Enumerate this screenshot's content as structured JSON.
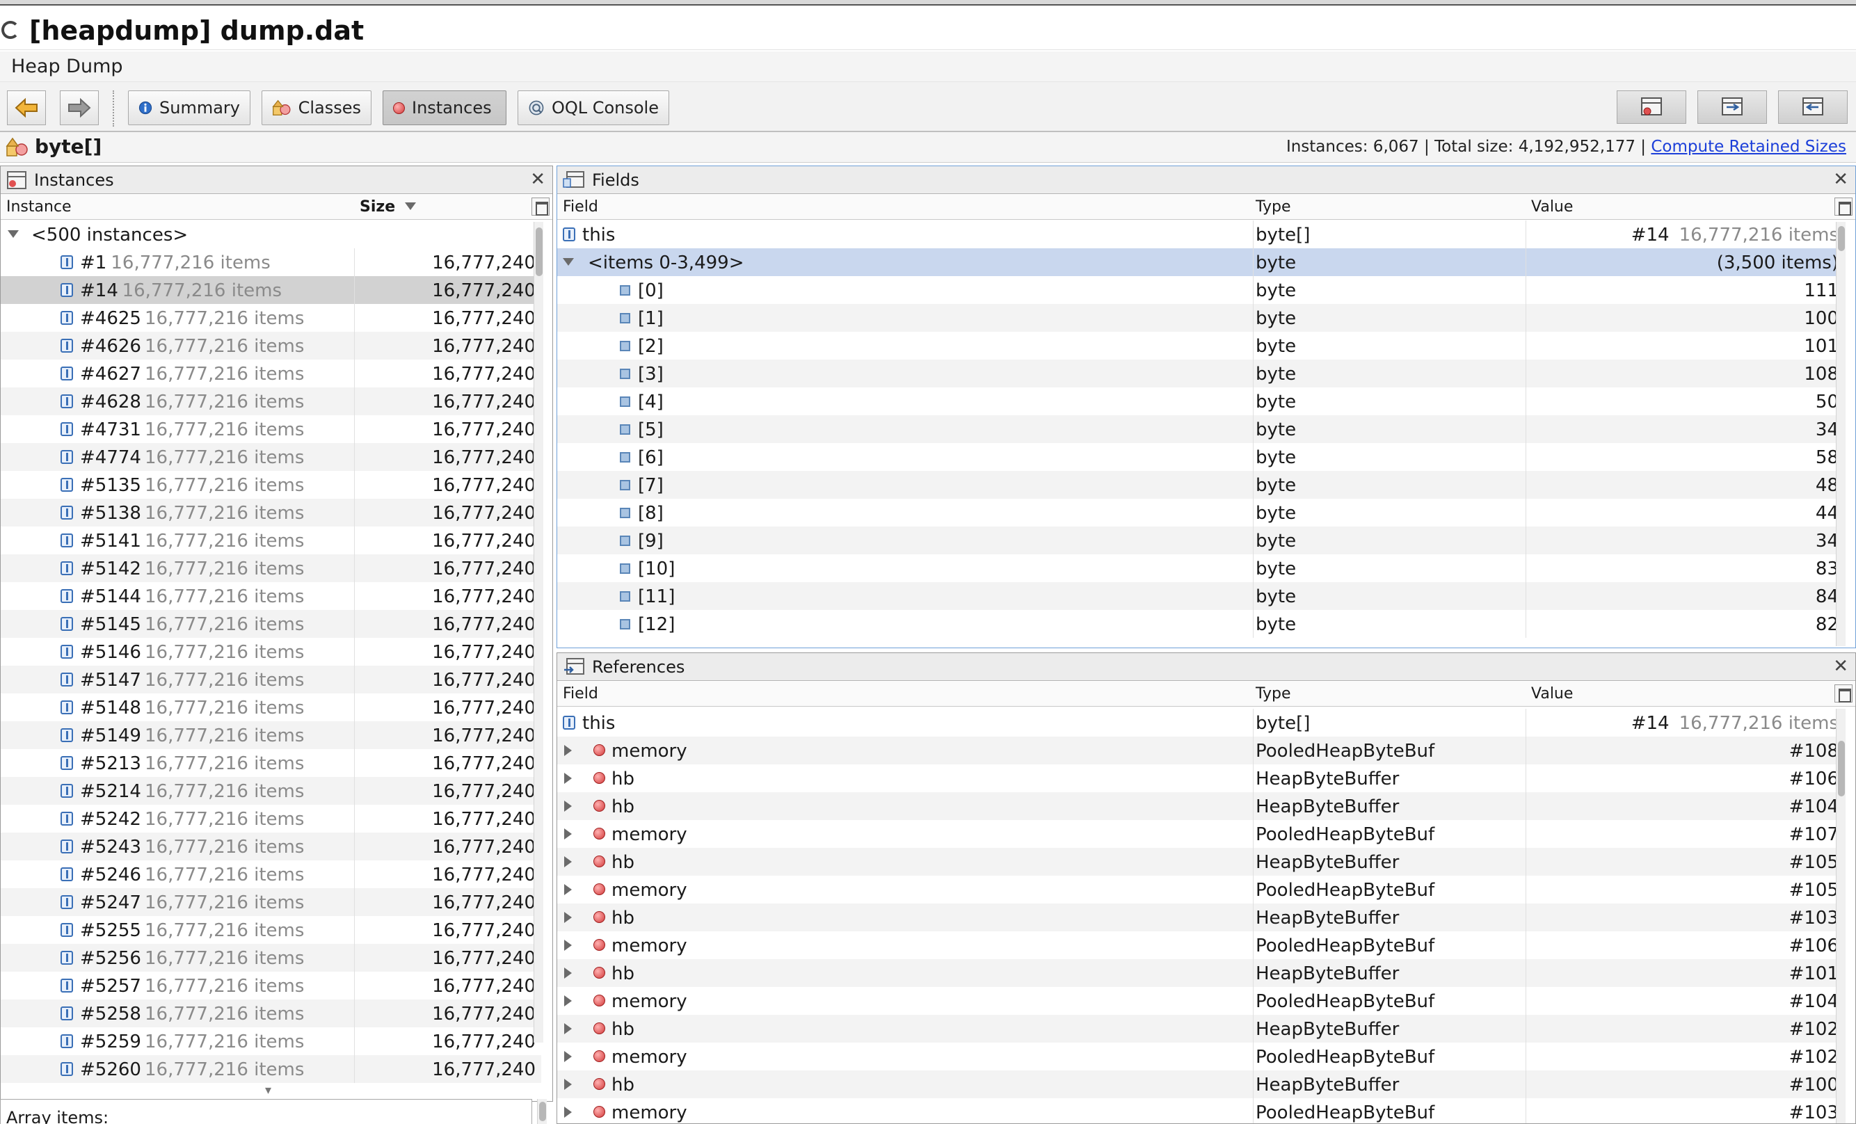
{
  "window": {
    "title": "[heapdump] dump.dat",
    "subtitle": "Heap Dump"
  },
  "toolbar": {
    "back_icon": "arrow-left-icon",
    "forward_icon": "arrow-right-icon",
    "buttons": [
      {
        "label": "Summary",
        "icon": "info-icon"
      },
      {
        "label": "Classes",
        "icon": "classes-icon"
      },
      {
        "label": "Instances",
        "icon": "instance-icon",
        "active": true
      },
      {
        "label": "OQL Console",
        "icon": "oql-icon"
      }
    ],
    "right_icons": [
      "view-icon-1",
      "view-icon-2",
      "view-icon-3"
    ]
  },
  "class_bar": {
    "class_name": "byte[]",
    "stats": "Instances: 6,067  |  Total size: 4,192,952,177  |",
    "compute_link": "Compute Retained Sizes"
  },
  "instances_panel": {
    "title": "Instances",
    "close": "✕",
    "columns": {
      "instance": "Instance",
      "size": "Size"
    },
    "group": "<500 instances>",
    "rows": [
      {
        "id": "#1",
        "items": "16,777,216 items",
        "size": "16,777,240"
      },
      {
        "id": "#14",
        "items": "16,777,216 items",
        "size": "16,777,240",
        "selected": true
      },
      {
        "id": "#4625",
        "items": "16,777,216 items",
        "size": "16,777,240"
      },
      {
        "id": "#4626",
        "items": "16,777,216 items",
        "size": "16,777,240"
      },
      {
        "id": "#4627",
        "items": "16,777,216 items",
        "size": "16,777,240"
      },
      {
        "id": "#4628",
        "items": "16,777,216 items",
        "size": "16,777,240"
      },
      {
        "id": "#4731",
        "items": "16,777,216 items",
        "size": "16,777,240"
      },
      {
        "id": "#4774",
        "items": "16,777,216 items",
        "size": "16,777,240"
      },
      {
        "id": "#5135",
        "items": "16,777,216 items",
        "size": "16,777,240"
      },
      {
        "id": "#5138",
        "items": "16,777,216 items",
        "size": "16,777,240"
      },
      {
        "id": "#5141",
        "items": "16,777,216 items",
        "size": "16,777,240"
      },
      {
        "id": "#5142",
        "items": "16,777,216 items",
        "size": "16,777,240"
      },
      {
        "id": "#5144",
        "items": "16,777,216 items",
        "size": "16,777,240"
      },
      {
        "id": "#5145",
        "items": "16,777,216 items",
        "size": "16,777,240"
      },
      {
        "id": "#5146",
        "items": "16,777,216 items",
        "size": "16,777,240"
      },
      {
        "id": "#5147",
        "items": "16,777,216 items",
        "size": "16,777,240"
      },
      {
        "id": "#5148",
        "items": "16,777,216 items",
        "size": "16,777,240"
      },
      {
        "id": "#5149",
        "items": "16,777,216 items",
        "size": "16,777,240"
      },
      {
        "id": "#5213",
        "items": "16,777,216 items",
        "size": "16,777,240"
      },
      {
        "id": "#5214",
        "items": "16,777,216 items",
        "size": "16,777,240"
      },
      {
        "id": "#5242",
        "items": "16,777,216 items",
        "size": "16,777,240"
      },
      {
        "id": "#5243",
        "items": "16,777,216 items",
        "size": "16,777,240"
      },
      {
        "id": "#5246",
        "items": "16,777,216 items",
        "size": "16,777,240"
      },
      {
        "id": "#5247",
        "items": "16,777,216 items",
        "size": "16,777,240"
      },
      {
        "id": "#5255",
        "items": "16,777,216 items",
        "size": "16,777,240"
      },
      {
        "id": "#5256",
        "items": "16,777,216 items",
        "size": "16,777,240"
      },
      {
        "id": "#5257",
        "items": "16,777,216 items",
        "size": "16,777,240"
      },
      {
        "id": "#5258",
        "items": "16,777,216 items",
        "size": "16,777,240"
      },
      {
        "id": "#5259",
        "items": "16,777,216 items",
        "size": "16,777,240"
      },
      {
        "id": "#5260",
        "items": "16,777,216 items",
        "size": "16,777,240"
      }
    ],
    "array_items_label": "Array items:"
  },
  "fields_panel": {
    "title": "Fields",
    "close": "✕",
    "columns": {
      "field": "Field",
      "type": "Type",
      "value": "Value"
    },
    "this_row": {
      "field": "this",
      "type": "byte[]",
      "value_id": "#14",
      "value_items": "16,777,216 items"
    },
    "group_row": {
      "field": "<items 0-3,499>",
      "type": "byte",
      "value": "(3,500 items)"
    },
    "rows": [
      {
        "field": "[0]",
        "type": "byte",
        "value": "111"
      },
      {
        "field": "[1]",
        "type": "byte",
        "value": "100"
      },
      {
        "field": "[2]",
        "type": "byte",
        "value": "101"
      },
      {
        "field": "[3]",
        "type": "byte",
        "value": "108"
      },
      {
        "field": "[4]",
        "type": "byte",
        "value": "50"
      },
      {
        "field": "[5]",
        "type": "byte",
        "value": "34"
      },
      {
        "field": "[6]",
        "type": "byte",
        "value": "58"
      },
      {
        "field": "[7]",
        "type": "byte",
        "value": "48"
      },
      {
        "field": "[8]",
        "type": "byte",
        "value": "44"
      },
      {
        "field": "[9]",
        "type": "byte",
        "value": "34"
      },
      {
        "field": "[10]",
        "type": "byte",
        "value": "83"
      },
      {
        "field": "[11]",
        "type": "byte",
        "value": "84"
      },
      {
        "field": "[12]",
        "type": "byte",
        "value": "82"
      }
    ]
  },
  "references_panel": {
    "title": "References",
    "close": "✕",
    "columns": {
      "field": "Field",
      "type": "Type",
      "value": "Value"
    },
    "this_row": {
      "field": "this",
      "type": "byte[]",
      "value_id": "#14",
      "value_items": "16,777,216 items"
    },
    "rows": [
      {
        "field": "memory",
        "type": "PooledHeapByteBuf",
        "value": "#108"
      },
      {
        "field": "hb",
        "type": "HeapByteBuffer",
        "value": "#106"
      },
      {
        "field": "hb",
        "type": "HeapByteBuffer",
        "value": "#104"
      },
      {
        "field": "memory",
        "type": "PooledHeapByteBuf",
        "value": "#107"
      },
      {
        "field": "hb",
        "type": "HeapByteBuffer",
        "value": "#105"
      },
      {
        "field": "memory",
        "type": "PooledHeapByteBuf",
        "value": "#105"
      },
      {
        "field": "hb",
        "type": "HeapByteBuffer",
        "value": "#103"
      },
      {
        "field": "memory",
        "type": "PooledHeapByteBuf",
        "value": "#106"
      },
      {
        "field": "hb",
        "type": "HeapByteBuffer",
        "value": "#101"
      },
      {
        "field": "memory",
        "type": "PooledHeapByteBuf",
        "value": "#104"
      },
      {
        "field": "hb",
        "type": "HeapByteBuffer",
        "value": "#102"
      },
      {
        "field": "memory",
        "type": "PooledHeapByteBuf",
        "value": "#102"
      },
      {
        "field": "hb",
        "type": "HeapByteBuffer",
        "value": "#100"
      },
      {
        "field": "memory",
        "type": "PooledHeapByteBuf",
        "value": "#103"
      }
    ]
  }
}
